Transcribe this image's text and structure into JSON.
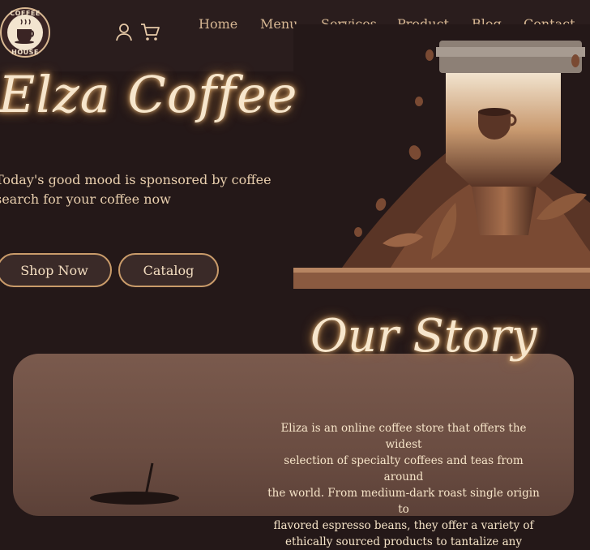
{
  "brand": {
    "logo_top": "COFFEE",
    "logo_bottom": "HOUSE"
  },
  "header": {
    "icons": [
      "user-icon",
      "cart-icon"
    ],
    "nav": [
      "Home",
      "Menu",
      "Services",
      "Product",
      "Blog",
      "Contact"
    ]
  },
  "hero": {
    "title": "Elza Coffee",
    "tagline_line1": "Today's good mood is sponsored by coffee",
    "tagline_line2": "search for your coffee now",
    "shop_now": "Shop Now",
    "catalog": "Catalog"
  },
  "story": {
    "title": "Our Story",
    "line1": "Eliza is an online coffee store that offers the widest",
    "line2": "selection of specialty coffees and teas from around",
    "line3": "the world. From medium-dark roast single origin to",
    "line4": "flavored espresso beans, they offer a variety of",
    "line5": "ethically sourced products to tantalize any"
  },
  "colors": {
    "background": "#241818",
    "header": "#2a1d1d",
    "accent": "#c99b6a",
    "card": "#6b4d42"
  }
}
